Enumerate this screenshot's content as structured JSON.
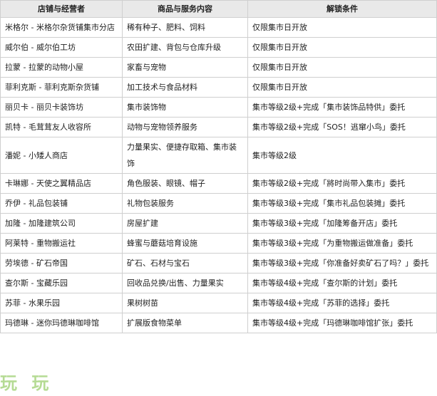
{
  "headers": [
    "店铺与经营者",
    "商品与服务内容",
    "解锁条件"
  ],
  "rows": [
    [
      "米格尔 - 米格尔杂货铺集市分店",
      "稀有种子、肥料、饲料",
      "仅限集市日开放"
    ],
    [
      "威尔伯 - 威尔伯工坊",
      "农田扩建、背包与仓库升级",
      "仅限集市日开放"
    ],
    [
      "拉蒙 - 拉蒙的动物小屋",
      "家畜与宠物",
      "仅限集市日开放"
    ],
    [
      "菲利克斯 - 菲利克斯杂货铺",
      "加工技术与食品材料",
      "仅限集市日开放"
    ],
    [
      "丽贝卡 - 丽贝卡装饰坊",
      "集市装饰物",
      "集市等级2级+完成「集市装饰品特供」委托"
    ],
    [
      "凯特 - 毛茸茸友人收容所",
      "动物与宠物领养服务",
      "集市等级2级+完成「SOS！逃窜小鸟」委托"
    ],
    [
      "潘妮 - 小矮人商店",
      "力量果实、便捷存取箱、集市装饰",
      "集市等级2级"
    ],
    [
      "卡琳娜 - 天使之翼精品店",
      "角色服装、眼镜、帽子",
      "集市等级2级+完成「將时尚带入集市」委托"
    ],
    [
      "乔伊 - 礼品包装铺",
      "礼物包装服务",
      "集市等级3级+完成「集市礼品包装摊」委托"
    ],
    [
      "加隆 - 加隆建筑公司",
      "房屋扩建",
      "集市等级3级+完成「加隆筹备开店」委托"
    ],
    [
      "阿莱特 - 重物搬运社",
      "蜂蜜与蘑菇培育设施",
      "集市等级3级+完成「为重物搬运做准备」委托"
    ],
    [
      "劳埃德 - 矿石帝国",
      "矿石、石材与宝石",
      "集市等级3级+完成「你准备好卖矿石了吗？」委托"
    ],
    [
      "查尔斯 - 宝藏乐园",
      "回收品兑换/出售、力量果实",
      "集市等级4级+完成「查尔斯的计划」委托"
    ],
    [
      "苏菲 - 水果乐园",
      "果树树苗",
      "集市等级4级+完成「苏菲的选择」委托"
    ],
    [
      "玛德琳 - 迷你玛德琳咖啡馆",
      "扩展版食物菜单",
      "集市等级4级+完成「玛德琳咖啡馆扩张」委托"
    ]
  ],
  "watermark": "玩 玩"
}
